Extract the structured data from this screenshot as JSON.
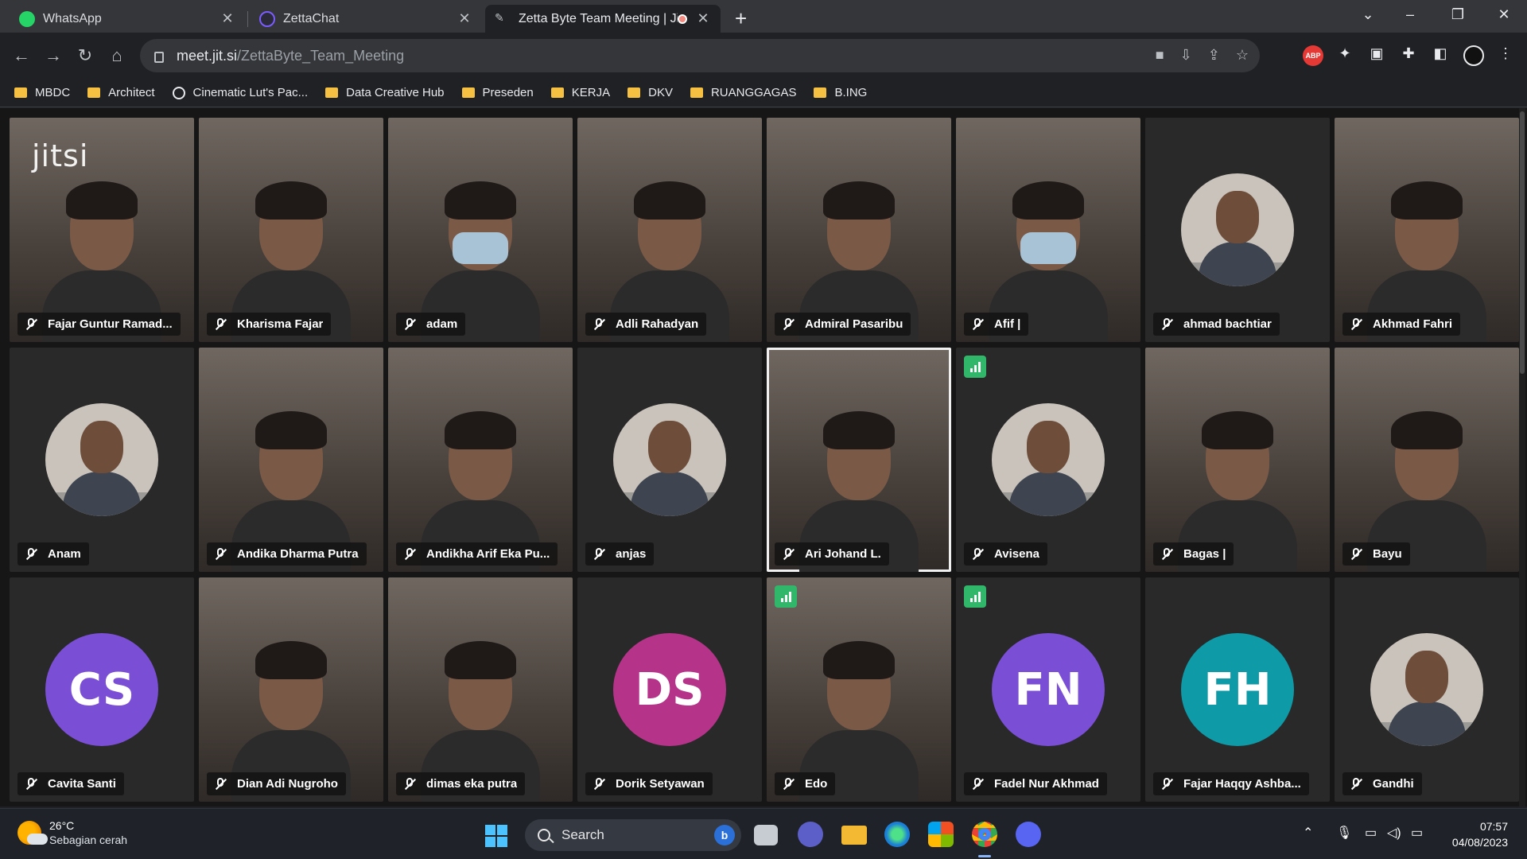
{
  "browser": {
    "tabs": [
      {
        "title": "WhatsApp",
        "icon": "whatsapp-icon",
        "color": "#25d366"
      },
      {
        "title": "ZettaChat",
        "icon": "zettachat-icon",
        "color": "#7b5cff"
      },
      {
        "title": "Zetta Byte Team Meeting | Jit",
        "icon": "jitsi-tab-icon",
        "color": "#e8eaed"
      }
    ],
    "url_host": "meet.jit.si",
    "url_path": "/ZettaByte_Team_Meeting",
    "extension_abp": "ABP",
    "bookmarks": [
      {
        "label": "MBDC",
        "type": "folder"
      },
      {
        "label": "Architect",
        "type": "folder"
      },
      {
        "label": "Cinematic Lut's Pac...",
        "type": "site"
      },
      {
        "label": "Data Creative Hub",
        "type": "folder"
      },
      {
        "label": "Preseden",
        "type": "folder"
      },
      {
        "label": "KERJA",
        "type": "folder"
      },
      {
        "label": "DKV",
        "type": "folder"
      },
      {
        "label": "RUANGGAGAS",
        "type": "folder"
      },
      {
        "label": "B.ING",
        "type": "folder"
      }
    ]
  },
  "meeting": {
    "logo": "jitsi",
    "participants": [
      {
        "name": "Fajar Guntur Ramad...",
        "kind": "video"
      },
      {
        "name": "Kharisma Fajar",
        "kind": "video"
      },
      {
        "name": "adam",
        "kind": "video-mask"
      },
      {
        "name": "Adli Rahadyan",
        "kind": "video"
      },
      {
        "name": "Admiral Pasaribu",
        "kind": "video"
      },
      {
        "name": "Afif |",
        "kind": "video-mask"
      },
      {
        "name": "ahmad bachtiar",
        "kind": "avatar-photo"
      },
      {
        "name": "Akhmad Fahri",
        "kind": "video"
      },
      {
        "name": "Anam",
        "kind": "avatar-photo"
      },
      {
        "name": "Andika Dharma Putra",
        "kind": "video"
      },
      {
        "name": "Andikha Arif Eka Pu...",
        "kind": "video"
      },
      {
        "name": "anjas",
        "kind": "avatar-photo"
      },
      {
        "name": "Ari Johand L.",
        "kind": "video",
        "active": true
      },
      {
        "name": "Avisena",
        "kind": "avatar-photo",
        "signal": true
      },
      {
        "name": "Bagas |",
        "kind": "video"
      },
      {
        "name": "Bayu",
        "kind": "video"
      },
      {
        "name": "Cavita Santi",
        "kind": "initials",
        "initials": "CS",
        "color": "#7a4fd6"
      },
      {
        "name": "Dian Adi Nugroho",
        "kind": "video"
      },
      {
        "name": "dimas eka putra",
        "kind": "video"
      },
      {
        "name": "Dorik Setyawan",
        "kind": "initials",
        "initials": "DS",
        "color": "#b5348a"
      },
      {
        "name": "Edo",
        "kind": "video",
        "signal": true
      },
      {
        "name": "Fadel Nur Akhmad",
        "kind": "initials",
        "initials": "FN",
        "color": "#7a4fd6",
        "signal": true
      },
      {
        "name": "Fajar Haqqy Ashba...",
        "kind": "initials",
        "initials": "FH",
        "color": "#0f9aa8"
      },
      {
        "name": "Gandhi",
        "kind": "avatar-photo"
      }
    ]
  },
  "taskbar": {
    "weather_temp": "26°C",
    "weather_desc": "Sebagian cerah",
    "search_placeholder": "Search",
    "time": "07:57",
    "date": "04/08/2023"
  }
}
